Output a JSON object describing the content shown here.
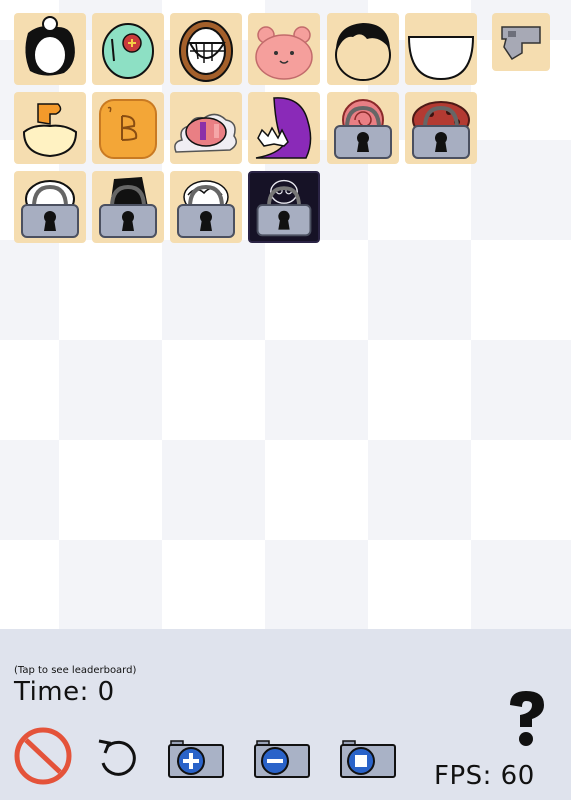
{
  "palette": {
    "items": [
      {
        "name": "character-black-white-face",
        "locked": false
      },
      {
        "name": "character-teal-cross-eye",
        "locked": false
      },
      {
        "name": "character-wide-smile-frame",
        "locked": false
      },
      {
        "name": "character-pink-bear",
        "locked": false
      },
      {
        "name": "character-black-hair-face",
        "locked": false
      },
      {
        "name": "character-white-blob",
        "locked": false
      },
      {
        "name": "character-gray-gun",
        "locked": false
      },
      {
        "name": "character-cream-blob-orange-hat",
        "locked": false
      },
      {
        "name": "character-orange-b-block",
        "locked": false
      },
      {
        "name": "character-pink-eye-cloud",
        "locked": false
      },
      {
        "name": "character-purple-sharp-mouth",
        "locked": false
      },
      {
        "name": "character-pink-spiral-locked",
        "locked": true
      },
      {
        "name": "character-red-pattern-locked",
        "locked": true
      },
      {
        "name": "character-white-round-locked",
        "locked": true
      },
      {
        "name": "character-black-creature-locked",
        "locked": true
      },
      {
        "name": "character-white-curly-locked",
        "locked": true
      },
      {
        "name": "character-dark-ghost-locked",
        "locked": true
      }
    ]
  },
  "footer": {
    "leaderboard_hint": "(Tap to see leaderboard)",
    "time_label": "Time: 0",
    "fps_label": "FPS: 60"
  },
  "icons": {
    "stop": "no-entry-icon",
    "reset": "reload-icon",
    "camera_add": "camera-plus-icon",
    "camera_remove": "camera-minus-icon",
    "camera_stop": "camera-stop-icon",
    "help": "question-mark-icon"
  },
  "colors": {
    "tile": "#f5ddb0",
    "panel": "#dfe3ed",
    "stop_red": "#e4533a",
    "camera_blue": "#2a63c9"
  }
}
